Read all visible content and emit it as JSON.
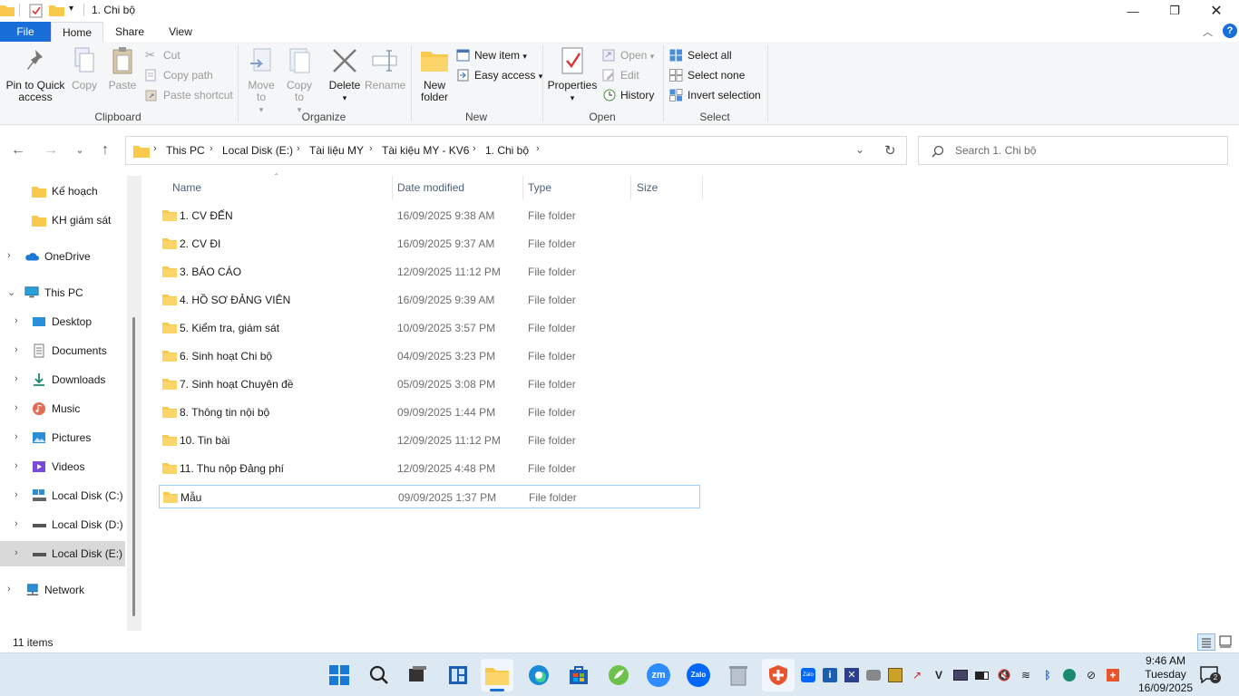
{
  "window": {
    "title": "1. Chi bộ",
    "colors": {
      "accent": "#1a6ed8",
      "folder": "#f8c94a",
      "selection_border": "#99d1ff",
      "taskbar": "#dce9f3"
    }
  },
  "ribbon_tabs": {
    "file": "File",
    "home": "Home",
    "share": "Share",
    "view": "View"
  },
  "ribbon": {
    "clipboard": {
      "pin": "Pin to Quick access",
      "copy": "Copy",
      "paste": "Paste",
      "cut": "Cut",
      "copy_path": "Copy path",
      "paste_shortcut": "Paste shortcut",
      "label": "Clipboard"
    },
    "organize": {
      "move_to": "Move to",
      "copy_to": "Copy to",
      "delete": "Delete",
      "rename": "Rename",
      "label": "Organize"
    },
    "new": {
      "new_folder": "New folder",
      "new_item": "New item",
      "easy_access": "Easy access",
      "label": "New"
    },
    "open": {
      "properties": "Properties",
      "open": "Open",
      "edit": "Edit",
      "history": "History",
      "label": "Open"
    },
    "select": {
      "select_all": "Select all",
      "select_none": "Select none",
      "invert_selection": "Invert selection",
      "label": "Select"
    }
  },
  "address": {
    "breadcrumbs": [
      "This PC",
      "Local Disk (E:)",
      "Tài liệu MY",
      "Tài kiệu MY - KV6",
      "1. Chi bộ"
    ],
    "search_placeholder": "Search 1. Chi bộ"
  },
  "nav_pane": {
    "items": [
      {
        "label": "Kế hoạch",
        "icon": "folder-icon"
      },
      {
        "label": "KH giám sát",
        "icon": "folder-icon"
      },
      {
        "label": "OneDrive",
        "icon": "cloud-icon"
      },
      {
        "label": "This PC",
        "icon": "computer-icon"
      },
      {
        "label": "Desktop",
        "icon": "desktop-icon"
      },
      {
        "label": "Documents",
        "icon": "documents-icon"
      },
      {
        "label": "Downloads",
        "icon": "download-icon"
      },
      {
        "label": "Music",
        "icon": "music-icon"
      },
      {
        "label": "Pictures",
        "icon": "pictures-icon"
      },
      {
        "label": "Videos",
        "icon": "videos-icon"
      },
      {
        "label": "Local Disk (C:)",
        "icon": "drive-icon"
      },
      {
        "label": "Local Disk (D:)",
        "icon": "drive-icon"
      },
      {
        "label": "Local Disk (E:)",
        "icon": "drive-icon"
      },
      {
        "label": "Network",
        "icon": "network-icon"
      }
    ]
  },
  "file_list": {
    "columns": {
      "name": "Name",
      "date": "Date modified",
      "type": "Type",
      "size": "Size"
    },
    "rows": [
      {
        "name": "1. CV ĐẾN",
        "date": "16/09/2025 9:38 AM",
        "type": "File folder"
      },
      {
        "name": "2. CV ĐI",
        "date": "16/09/2025 9:37 AM",
        "type": "File folder"
      },
      {
        "name": "3. BÁO CÁO",
        "date": "12/09/2025 11:12 PM",
        "type": "File folder"
      },
      {
        "name": "4. HỒ SƠ ĐẢNG VIÊN",
        "date": "16/09/2025 9:39 AM",
        "type": "File folder"
      },
      {
        "name": "5. Kiểm tra, giám sát",
        "date": "10/09/2025 3:57 PM",
        "type": "File folder"
      },
      {
        "name": "6. Sinh hoạt Chi bộ",
        "date": "04/09/2025 3:23 PM",
        "type": "File folder"
      },
      {
        "name": "7. Sinh hoạt Chuyên đề",
        "date": "05/09/2025 3:08 PM",
        "type": "File folder"
      },
      {
        "name": "8. Thông tin nội bộ",
        "date": "09/09/2025 1:44 PM",
        "type": "File folder"
      },
      {
        "name": "10. Tin bài",
        "date": "12/09/2025 11:12 PM",
        "type": "File folder"
      },
      {
        "name": "11. Thu nộp Đảng phí",
        "date": "12/09/2025 4:48 PM",
        "type": "File folder"
      },
      {
        "name": "Mẫu",
        "date": "09/09/2025 1:37 PM",
        "type": "File folder"
      }
    ]
  },
  "status": {
    "item_count": "11 items"
  },
  "taskbar": {
    "zalo_label": "Zalo",
    "zm_label": "zm",
    "clock_time": "9:46 AM",
    "clock_day": "Tuesday",
    "clock_date": "16/09/2025",
    "notification_count": "2"
  }
}
